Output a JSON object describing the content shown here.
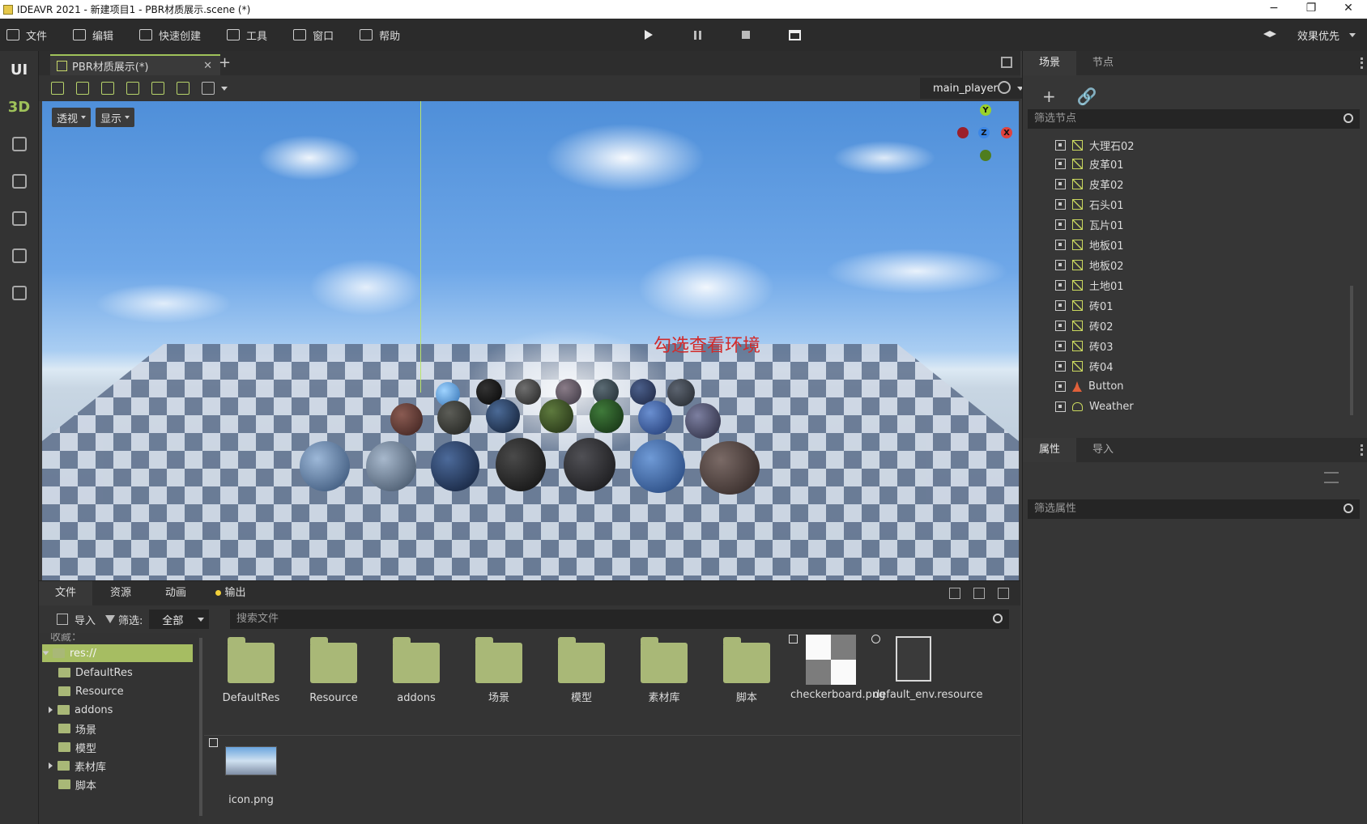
{
  "titlebar": {
    "title": "IDEAVR 2021 - 新建项目1 - PBR材质展示.scene (*)",
    "minimize": "−",
    "maximize": "❐",
    "close": "✕"
  },
  "menu": {
    "items": [
      {
        "label": "文件",
        "icon": "folder-icon"
      },
      {
        "label": "编辑",
        "icon": "crop-icon"
      },
      {
        "label": "快速创建",
        "icon": "edit-icon"
      },
      {
        "label": "工具",
        "icon": "window-icon"
      },
      {
        "label": "窗口",
        "icon": "frame-icon"
      },
      {
        "label": "帮助",
        "icon": "book-icon"
      }
    ],
    "quality": "效果优先"
  },
  "left_toolbar": {
    "ui": "UI",
    "three_d": "3D"
  },
  "editor_tab": {
    "label": "PBR材质展示(*)",
    "close": "✕",
    "add": "+"
  },
  "viewport_toolbar": {
    "player": "main_player"
  },
  "viewport": {
    "perspective_btn": "透视",
    "display_btn": "显示",
    "gizmo": {
      "x": "X",
      "y": "Y",
      "z": "Z"
    },
    "overlay_text": "勾选查看环境",
    "colors": {
      "sky_top": "#4f8fd9",
      "floor_dark": "#5d6f8b",
      "overlay_text": "#d22a2a"
    }
  },
  "bottom_panel": {
    "tabs": [
      "文件",
      "资源",
      "动画",
      "输出"
    ],
    "import_label": "导入",
    "filter_label": "筛选:",
    "filter_value": "全部",
    "search_placeholder": "搜索文件",
    "tree": {
      "favorites": "收藏：",
      "root": "res://",
      "children": [
        "DefaultRes",
        "Resource",
        "addons",
        "场景",
        "模型",
        "素材库",
        "脚本"
      ]
    },
    "files": [
      {
        "name": "DefaultRes",
        "kind": "folder"
      },
      {
        "name": "Resource",
        "kind": "folder"
      },
      {
        "name": "addons",
        "kind": "folder"
      },
      {
        "name": "场景",
        "kind": "folder"
      },
      {
        "name": "模型",
        "kind": "folder"
      },
      {
        "name": "素材库",
        "kind": "folder"
      },
      {
        "name": "脚本",
        "kind": "folder"
      },
      {
        "name": "checkerboard.png",
        "kind": "image"
      },
      {
        "name": "default_env.resource",
        "kind": "resource"
      },
      {
        "name": "icon.png",
        "kind": "image"
      }
    ],
    "accent": "#a6bd62"
  },
  "right_dock": {
    "scene_tabs": [
      "场景",
      "节点"
    ],
    "filter_nodes": "筛选节点",
    "nodes": [
      {
        "label": "大理石02",
        "icon": "mesh-icon"
      },
      {
        "label": "皮革01",
        "icon": "mesh-icon"
      },
      {
        "label": "皮革02",
        "icon": "mesh-icon"
      },
      {
        "label": "石头01",
        "icon": "mesh-icon"
      },
      {
        "label": "瓦片01",
        "icon": "mesh-icon"
      },
      {
        "label": "地板01",
        "icon": "mesh-icon"
      },
      {
        "label": "地板02",
        "icon": "mesh-icon"
      },
      {
        "label": "土地01",
        "icon": "mesh-icon"
      },
      {
        "label": "砖01",
        "icon": "mesh-icon"
      },
      {
        "label": "砖02",
        "icon": "mesh-icon"
      },
      {
        "label": "砖03",
        "icon": "mesh-icon"
      },
      {
        "label": "砖04",
        "icon": "mesh-icon"
      },
      {
        "label": "Button",
        "icon": "button-node-icon"
      },
      {
        "label": "Weather",
        "icon": "weather-icon"
      }
    ],
    "prop_tabs": [
      "属性",
      "导入"
    ],
    "filter_props": "筛选属性"
  }
}
